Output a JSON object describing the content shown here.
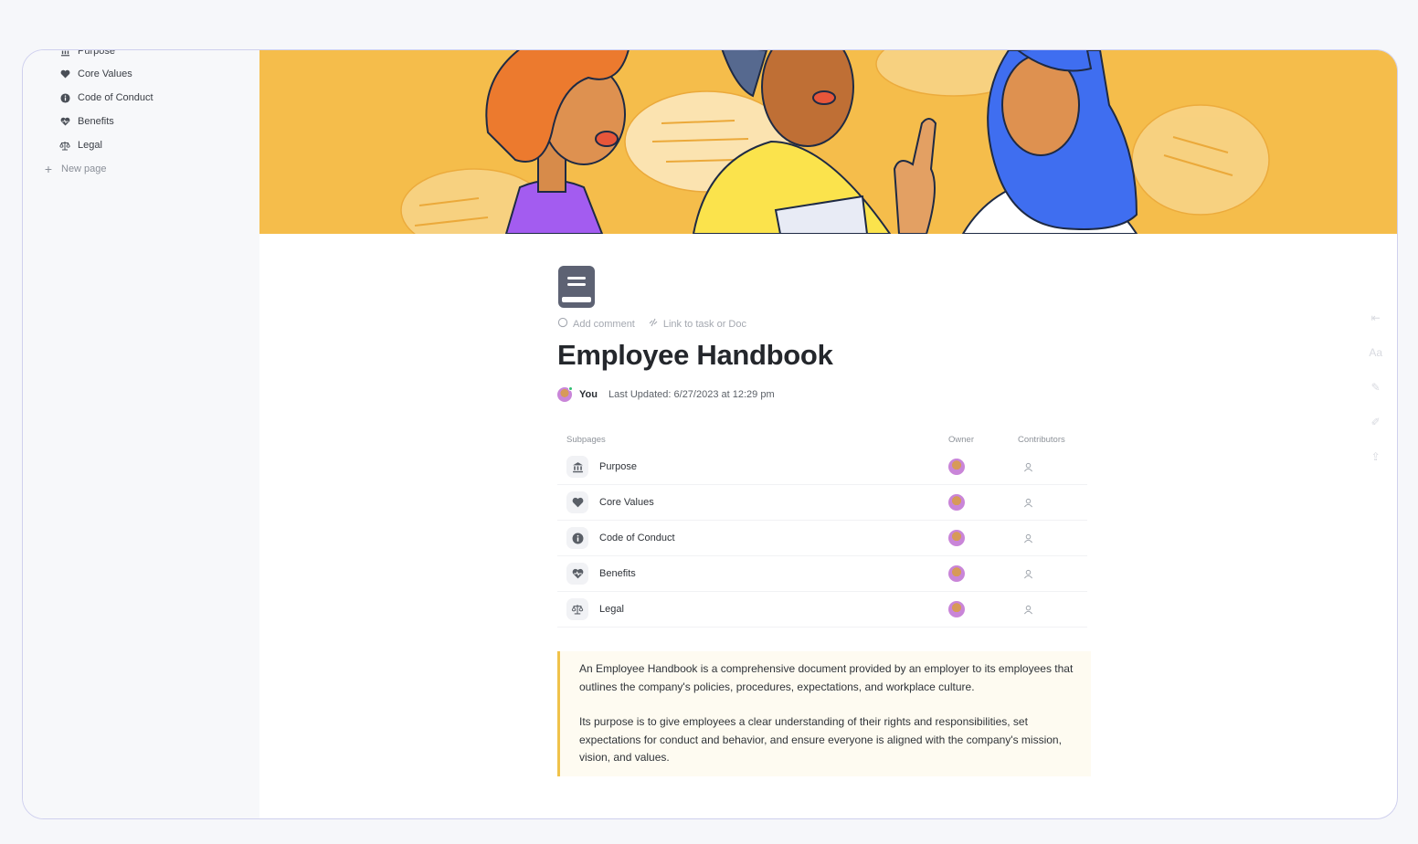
{
  "sidebar": {
    "items": [
      {
        "label": "Purpose",
        "icon": "bank-icon"
      },
      {
        "label": "Core Values",
        "icon": "heart-icon"
      },
      {
        "label": "Code of Conduct",
        "icon": "info-icon"
      },
      {
        "label": "Benefits",
        "icon": "heart-pulse-icon"
      },
      {
        "label": "Legal",
        "icon": "scale-icon"
      }
    ],
    "new_page_label": "New page"
  },
  "doc": {
    "add_comment_label": "Add comment",
    "link_label": "Link to task or Doc",
    "title": "Employee Handbook",
    "author": "You",
    "last_updated": "Last Updated: 6/27/2023 at 12:29 pm"
  },
  "subpages": {
    "headers": {
      "name": "Subpages",
      "owner": "Owner",
      "contributors": "Contributors"
    },
    "rows": [
      {
        "name": "Purpose",
        "icon": "bank-icon"
      },
      {
        "name": "Core Values",
        "icon": "heart-icon"
      },
      {
        "name": "Code of Conduct",
        "icon": "info-icon"
      },
      {
        "name": "Benefits",
        "icon": "heart-pulse-icon"
      },
      {
        "name": "Legal",
        "icon": "scale-icon"
      }
    ]
  },
  "callout": {
    "paragraphs": [
      "An Employee Handbook is a comprehensive document provided by an employer to its employees that outlines the company's policies, procedures, expectations, and workplace culture.",
      "Its purpose is to give employees a clear understanding of their rights and responsibilities, set expectations for conduct and behavior, and ensure everyone is aligned with the company's mission, vision, and values."
    ]
  },
  "right_tools": [
    {
      "icon": "collapse-icon",
      "text": "⇤"
    },
    {
      "icon": "font-icon",
      "text": "Aa"
    },
    {
      "icon": "edit-icon",
      "text": "✎"
    },
    {
      "icon": "magic-icon",
      "text": "✐"
    },
    {
      "icon": "share-icon",
      "text": "⇪"
    }
  ],
  "colors": {
    "banner": "#f5bd4b",
    "callout_border": "#f0c24a",
    "frame_border": "#cfd0ee"
  }
}
